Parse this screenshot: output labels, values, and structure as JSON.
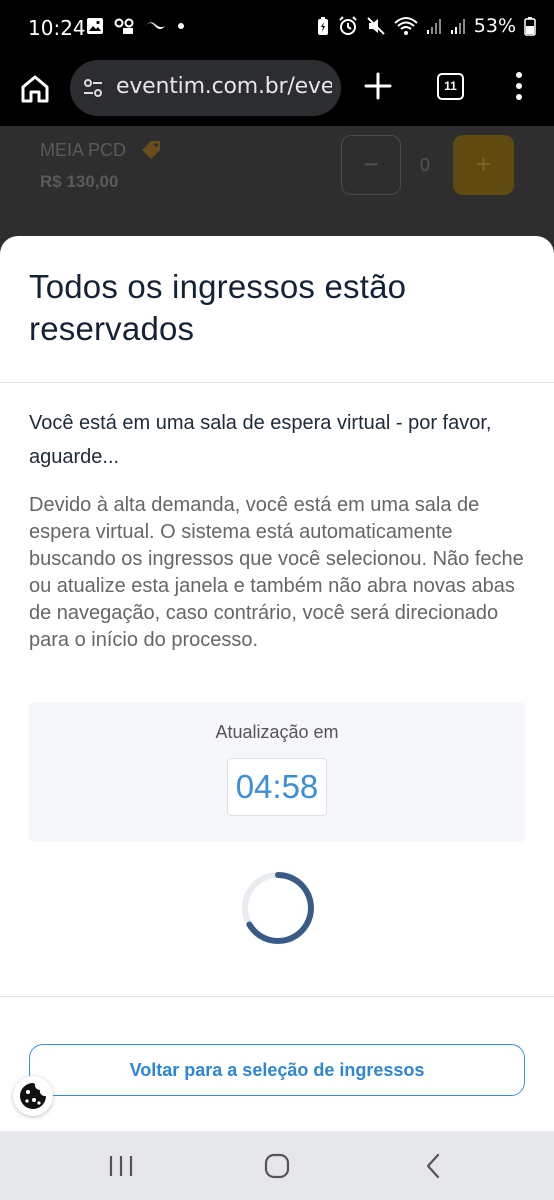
{
  "status_bar": {
    "time": "10:24",
    "battery_percent": "53%",
    "left_icons": [
      "image-icon",
      "voicemail-icon",
      "messenger-icon",
      "dot-icon"
    ],
    "right_icons": [
      "battery-saver-icon",
      "alarm-icon",
      "mute-icon",
      "wifi-icon",
      "signal-icon",
      "signal-icon",
      "battery-icon"
    ]
  },
  "browser": {
    "url": "eventim.com.br/even",
    "tab_count": "11",
    "icons": {
      "home": "home-icon",
      "site": "tune-icon",
      "new_tab": "plus-icon",
      "menu": "more-vert-icon"
    }
  },
  "background_page": {
    "ticket_name": "MEIA PCD",
    "ticket_price": "R$ 130,00",
    "quantity": "0",
    "minus_label": "−",
    "plus_label": "+"
  },
  "modal": {
    "title": "Todos os ingressos estão reservados",
    "subtitle": "Você está em uma sala de espera virtual - por favor, aguarde...",
    "body": "Devido à alta demanda, você está em uma sala de espera virtual. O sistema está automaticamente buscando os ingressos que você selecionou. Não feche ou atualize esta janela e também não abra novas abas de navegação, caso contrário, você será direcionado para o início do processo.",
    "timer_label": "Atualização em",
    "timer_value": "04:58",
    "back_button": "Voltar para a seleção de ingressos"
  },
  "colors": {
    "accent": "#3d8ed8",
    "title": "#152236",
    "spinner": "#3a5a87",
    "background_plus": "#5f4a10"
  }
}
